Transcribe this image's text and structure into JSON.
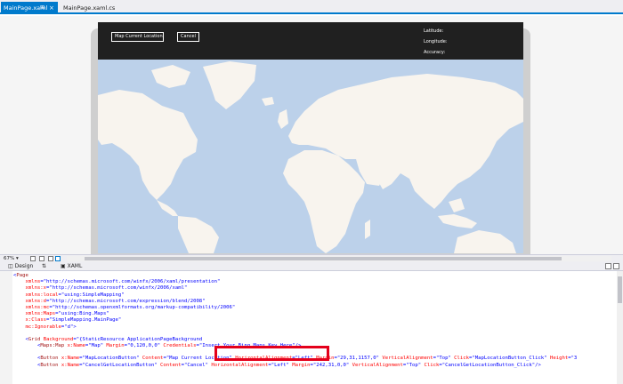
{
  "tabs": [
    {
      "label": "MainPage.xaml",
      "active": true
    },
    {
      "label": "MainPage.xaml.cs",
      "active": false
    }
  ],
  "tab_icons": {
    "pin": "pin-icon",
    "close": "close-icon"
  },
  "app": {
    "map_button": "Map Current Location",
    "cancel_button": "Cancel",
    "latitude_label": "Latitude:",
    "longitude_label": "Longitude:",
    "accuracy_label": "Accuracy:"
  },
  "zoom": {
    "value": "67%"
  },
  "split_tabs": {
    "design": "Design",
    "swap": "⇅",
    "xaml": "XAML"
  },
  "code_lines": [
    [
      {
        "t": "<",
        "c": "p"
      },
      {
        "t": "Page",
        "c": "k"
      }
    ],
    [
      {
        "t": "    xmlns",
        "c": "a"
      },
      {
        "t": "=",
        "c": "p"
      },
      {
        "t": "\"http://schemas.microsoft.com/winfx/2006/xaml/presentation\"",
        "c": "s"
      }
    ],
    [
      {
        "t": "    xmlns:x",
        "c": "a"
      },
      {
        "t": "=",
        "c": "p"
      },
      {
        "t": "\"http://schemas.microsoft.com/winfx/2006/xaml\"",
        "c": "s"
      }
    ],
    [
      {
        "t": "    xmlns:local",
        "c": "a"
      },
      {
        "t": "=",
        "c": "p"
      },
      {
        "t": "\"using:SimpleMapping\"",
        "c": "s"
      }
    ],
    [
      {
        "t": "    xmlns:d",
        "c": "a"
      },
      {
        "t": "=",
        "c": "p"
      },
      {
        "t": "\"http://schemas.microsoft.com/expression/blend/2008\"",
        "c": "s"
      }
    ],
    [
      {
        "t": "    xmlns:mc",
        "c": "a"
      },
      {
        "t": "=",
        "c": "p"
      },
      {
        "t": "\"http://schemas.openxmlformats.org/markup-compatibility/2006\"",
        "c": "s"
      }
    ],
    [
      {
        "t": "    xmlns:Maps",
        "c": "a"
      },
      {
        "t": "=",
        "c": "p"
      },
      {
        "t": "\"using:Bing.Maps\"",
        "c": "s"
      }
    ],
    [
      {
        "t": "    x:Class",
        "c": "a"
      },
      {
        "t": "=",
        "c": "p"
      },
      {
        "t": "\"SimpleMapping.MainPage\"",
        "c": "s"
      }
    ],
    [
      {
        "t": "    mc:Ignorable",
        "c": "a"
      },
      {
        "t": "=",
        "c": "p"
      },
      {
        "t": "\"d\">",
        "c": "s"
      }
    ],
    [],
    [
      {
        "t": "    <",
        "c": "p"
      },
      {
        "t": "Grid",
        "c": "k"
      },
      {
        "t": " Background",
        "c": "a"
      },
      {
        "t": "=",
        "c": "p"
      },
      {
        "t": "\"{StaticResource ApplicationPageBackground",
        "c": "s"
      }
    ],
    [
      {
        "t": "        <",
        "c": "p"
      },
      {
        "t": "Maps:Map",
        "c": "k"
      },
      {
        "t": " x:Name",
        "c": "a"
      },
      {
        "t": "=",
        "c": "p"
      },
      {
        "t": "\"Map\"",
        "c": "s"
      },
      {
        "t": " Margin",
        "c": "a"
      },
      {
        "t": "=",
        "c": "p"
      },
      {
        "t": "\"0,120,0,0\"",
        "c": "s"
      },
      {
        "t": " Credentials",
        "c": "a"
      },
      {
        "t": "=",
        "c": "p"
      },
      {
        "t": "\"Insert Your Bing Maps Key Here\"",
        "c": "s"
      },
      {
        "t": "/>",
        "c": "p"
      }
    ],
    [],
    [
      {
        "t": "        <",
        "c": "p"
      },
      {
        "t": "Button",
        "c": "k"
      },
      {
        "t": " x:Name",
        "c": "a"
      },
      {
        "t": "=",
        "c": "p"
      },
      {
        "t": "\"MapLocationButton\"",
        "c": "s"
      },
      {
        "t": " Content",
        "c": "a"
      },
      {
        "t": "=",
        "c": "p"
      },
      {
        "t": "\"Map Current Location\"",
        "c": "s"
      },
      {
        "t": " HorizontalAlignment",
        "c": "a"
      },
      {
        "t": "=",
        "c": "p"
      },
      {
        "t": "\"Left\"",
        "c": "s"
      },
      {
        "t": " Margin",
        "c": "a"
      },
      {
        "t": "=",
        "c": "p"
      },
      {
        "t": "\"29,31,1157,0\"",
        "c": "s"
      },
      {
        "t": " VerticalAlignment",
        "c": "a"
      },
      {
        "t": "=",
        "c": "p"
      },
      {
        "t": "\"Top\"",
        "c": "s"
      },
      {
        "t": " Click",
        "c": "a"
      },
      {
        "t": "=",
        "c": "p"
      },
      {
        "t": "\"MapLocationButton_Click\"",
        "c": "s"
      },
      {
        "t": " Height",
        "c": "a"
      },
      {
        "t": "=",
        "c": "p"
      },
      {
        "t": "\"3",
        "c": "s"
      }
    ],
    [
      {
        "t": "        <",
        "c": "p"
      },
      {
        "t": "Button",
        "c": "k"
      },
      {
        "t": " x:Name",
        "c": "a"
      },
      {
        "t": "=",
        "c": "p"
      },
      {
        "t": "\"CancelGetLocationButton\"",
        "c": "s"
      },
      {
        "t": " Content",
        "c": "a"
      },
      {
        "t": "=",
        "c": "p"
      },
      {
        "t": "\"Cancel\"",
        "c": "s"
      },
      {
        "t": " HorizontalAlignment",
        "c": "a"
      },
      {
        "t": "=",
        "c": "p"
      },
      {
        "t": "\"Left\"",
        "c": "s"
      },
      {
        "t": " Margin",
        "c": "a"
      },
      {
        "t": "=",
        "c": "p"
      },
      {
        "t": "\"242,31,0,0\"",
        "c": "s"
      },
      {
        "t": " VerticalAlignment",
        "c": "a"
      },
      {
        "t": "=",
        "c": "p"
      },
      {
        "t": "\"Top\"",
        "c": "s"
      },
      {
        "t": " Click",
        "c": "a"
      },
      {
        "t": "=",
        "c": "p"
      },
      {
        "t": "\"CancelGetLocationButton_Click\"",
        "c": "s"
      },
      {
        "t": "/>",
        "c": "p"
      }
    ]
  ],
  "colors": {
    "accent": "#007acc",
    "app_bar": "#202020",
    "ocean": "#bcd1ea",
    "land": "#f8f4ee",
    "highlight": "#e4001b"
  }
}
